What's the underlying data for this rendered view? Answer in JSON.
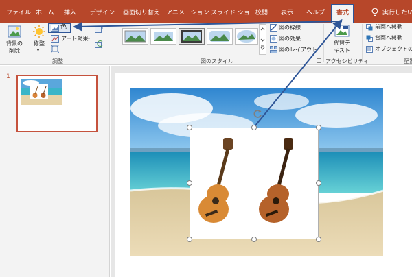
{
  "tabs": [
    {
      "label": "ファイル"
    },
    {
      "label": "ホーム"
    },
    {
      "label": "挿入"
    },
    {
      "label": "デザイン"
    },
    {
      "label": "画面切り替え"
    },
    {
      "label": "アニメーション"
    },
    {
      "label": "スライド ショー"
    },
    {
      "label": "校閲"
    },
    {
      "label": "表示"
    },
    {
      "label": "ヘルプ"
    },
    {
      "label": "書式",
      "active": true
    }
  ],
  "tell_me": {
    "label": "実行したい作業"
  },
  "ribbon": {
    "adjust": {
      "remove_background": "背景の\n削除",
      "corrections": "修整",
      "color": "色",
      "artistic_effects": "アート効果",
      "group_label": "調整"
    },
    "picture_styles": {
      "border": "図の枠線",
      "effects": "図の効果",
      "layout": "図のレイアウト",
      "group_label": "図のスタイル"
    },
    "accessibility": {
      "alt_text": "代替テ\nキスト",
      "group_label": "アクセシビリティ"
    },
    "arrange": {
      "bring_forward": "前面へ移動",
      "send_backward": "背面へ移動",
      "selection_pane": "オブジェクトの選",
      "group_label": "配置"
    }
  },
  "slides_pane": {
    "slide_number": "1"
  },
  "colors": {
    "accent": "#b7472a",
    "highlight": "#2e5597",
    "ribbon_bg": "#f3f3f3"
  },
  "icons": [
    "remove-background-icon",
    "corrections-icon",
    "color-icon",
    "artistic-effects-icon",
    "compress-icon",
    "change-picture-icon",
    "reset-picture-icon",
    "picture-border-icon",
    "picture-effects-icon",
    "picture-layout-icon",
    "alt-text-icon",
    "bring-forward-icon",
    "send-backward-icon",
    "selection-pane-icon",
    "lightbulb-icon",
    "rotate-icon"
  ]
}
